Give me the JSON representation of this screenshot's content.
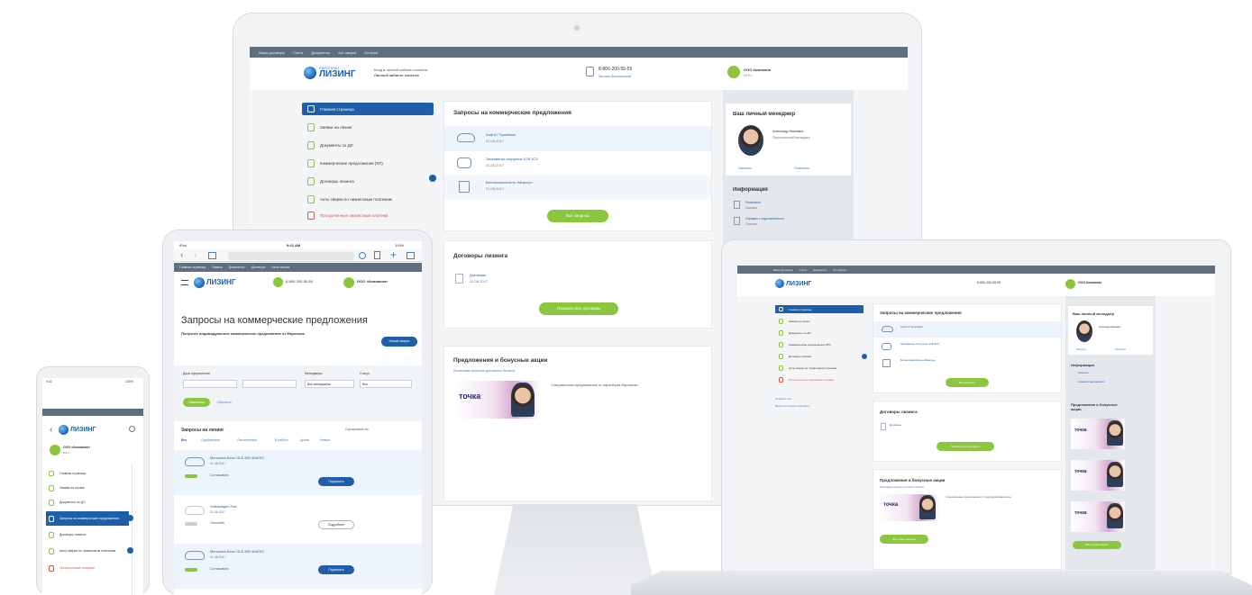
{
  "desktop": {
    "topnav": [
      "Ваши договоры",
      "Счета",
      "Документы",
      "Акт сверки",
      "Остатки"
    ],
    "logo": {
      "word1": "ЕВРОПЛАН",
      "word2": "ЛИЗИНГ"
    },
    "header_note": {
      "line1": "Вход в личный кабинет клиента",
      "line2": "Личный кабинет клиента"
    },
    "phone": {
      "number": "8-800-200-55-55",
      "note": "Звонок бесплатный"
    },
    "user": {
      "name": "ООО Компания",
      "id": "ИНН"
    },
    "sidebar": [
      {
        "label": "Главная страница",
        "active": true
      },
      {
        "label": "Заявки на лизинг"
      },
      {
        "label": "Документы по ДЛ"
      },
      {
        "label": "Коммерческие предложения (КП)"
      },
      {
        "label": "Договоры лизинга"
      },
      {
        "label": "Акты сверки по лизинговым платежам"
      },
      {
        "label": "Просроченные лизинговые платежи",
        "red": true
      }
    ],
    "requests": {
      "title": "Запросы на коммерческие предложения",
      "items": [
        {
          "name": "Audi A7 Sportback",
          "date": "01.06.2017"
        },
        {
          "name": "Экскаватор-погрузчик JCB 3CX",
          "date": "01.06.2017"
        },
        {
          "name": "Бетоносмеситель «Миксер»",
          "date": "01.06.2017"
        }
      ],
      "button": "Все запросы"
    },
    "invoices": {
      "title": "Договоры лизинга",
      "item_name": "Договоры",
      "item_date": "01.06.2017",
      "button": "Показать все договоры"
    },
    "promo": {
      "title": "Предложения и бонусные акции",
      "subtitle": "Лизинговые решения для вашего бизнеса",
      "brand": "точка",
      "text": "Специальные предложения от партнёров Европлан"
    },
    "manager": {
      "title": "Ваш личный менеджер",
      "name": "Александр Иванович",
      "role": "Персональный менеджер",
      "link1": "Написать",
      "link2": "Позвонить"
    },
    "info": {
      "title": "Информация",
      "items": [
        {
          "label": "Реквизиты",
          "sub": "Скачать"
        },
        {
          "label": "Справка о задолженности",
          "sub": "Скачать"
        }
      ]
    }
  },
  "tablet": {
    "status": {
      "left": "iPad",
      "center": "9:41 AM",
      "right": "100%"
    },
    "topnav": [
      "Главная страница",
      "Заявки",
      "Документы",
      "Договоры",
      "Акты сверки"
    ],
    "phone": "8-800-200-55-55",
    "user": "ООО «Компания»",
    "page_title": "Запросы на коммерческие предложения",
    "subtitle": "Получите индивидуальное коммерческое предложение от Европлан",
    "new_button": "Новый запрос",
    "filter_label1": "Дата оформления",
    "filter_label2": "Менеджеры",
    "filter_label3": "Статус",
    "filter_val2": "Все менеджеры",
    "filter_val3": "Все",
    "apply": "Применить",
    "reset": "Сбросить",
    "list_title": "Запросы на лизинг",
    "sort_label": "Сортировать по",
    "chips": [
      "Все",
      "Одобренные",
      "Отклонённые",
      "В работе",
      "Архив",
      "Новые"
    ],
    "rows": [
      {
        "name": "Mercedes-Benz GLE 350 4MATIC",
        "sub": "01.06.2017",
        "status": "Согласовано",
        "btn": "Подписать"
      },
      {
        "name": "Volkswagen Polo",
        "sub": "01.06.2017",
        "status": "Отклонён",
        "btn": "Подробнее"
      },
      {
        "name": "Mercedes-Benz GLE 350 4MATIC",
        "sub": "01.06.2017",
        "status": "Согласовано",
        "btn": "Подписать"
      }
    ]
  },
  "phone": {
    "status": {
      "left": "9:41",
      "right": "100%"
    },
    "user": {
      "name": "ООО «Компания»",
      "sub": "ИНН"
    },
    "menu": [
      {
        "label": "Главная страница"
      },
      {
        "label": "Заявки на лизинг"
      },
      {
        "label": "Документы по ДЛ"
      },
      {
        "label": "Запросы на коммерческие предложения",
        "active": true
      },
      {
        "label": "Договоры лизинга"
      },
      {
        "label": "Акты сверки по лизинговым платежам"
      },
      {
        "label": "Просроченные платежи",
        "red": true
      }
    ]
  },
  "laptop": {
    "sidebar_extra": [
      "Показать все",
      "Выйти из личного кабинета"
    ],
    "promo_right_title": "Предложения и бонусные акции",
    "btn_requests": "Все запросы",
    "btn_invoices": "Показать все договоры",
    "btn_promo": "Все предложения",
    "btn_right": "Все предложения"
  }
}
